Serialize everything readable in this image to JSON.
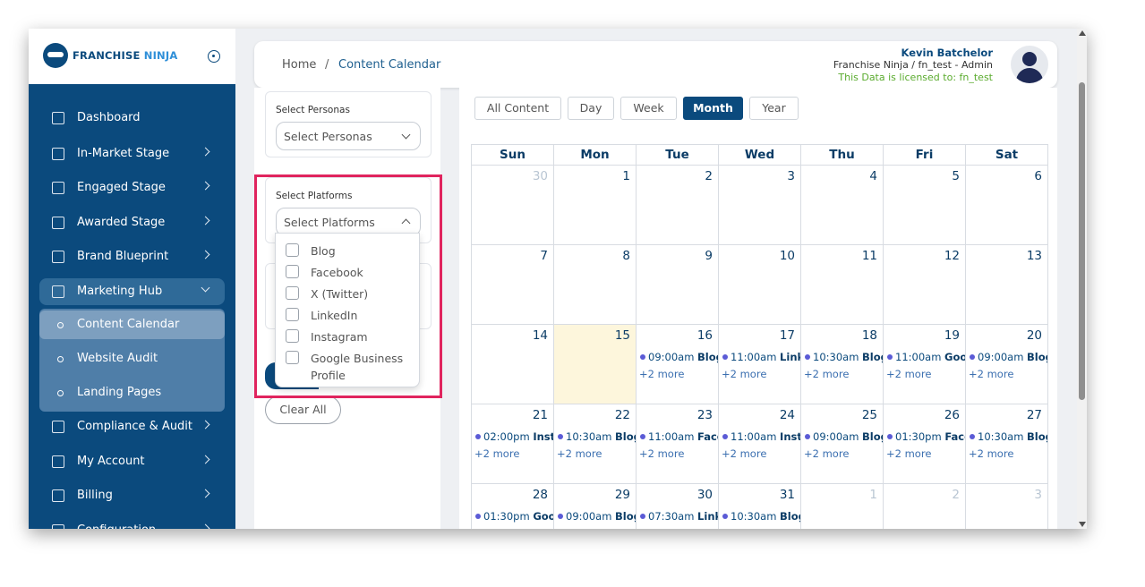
{
  "brand": {
    "name_part1": "FRANCHISE",
    "name_part2": "NINJA"
  },
  "sidebar": {
    "items": [
      {
        "label": "Dashboard",
        "icon": "home-icon",
        "chevron": false
      },
      {
        "label": "In-Market Stage",
        "icon": "store-icon",
        "chevron": true
      },
      {
        "label": "Engaged Stage",
        "icon": "people-icon",
        "chevron": true
      },
      {
        "label": "Awarded Stage",
        "icon": "runner-icon",
        "chevron": true
      },
      {
        "label": "Brand Blueprint",
        "icon": "book-icon",
        "chevron": true
      },
      {
        "label": "Marketing Hub",
        "icon": "network-icon",
        "chevron": true,
        "expanded": true
      },
      {
        "label": "Compliance & Audit",
        "icon": "clipboard-icon",
        "chevron": true
      },
      {
        "label": "My Account",
        "icon": "user-icon",
        "chevron": true
      },
      {
        "label": "Billing",
        "icon": "card-icon",
        "chevron": true
      },
      {
        "label": "Configuration",
        "icon": "gear-icon",
        "chevron": true
      }
    ],
    "submenu": [
      {
        "label": "Content Calendar",
        "selected": true
      },
      {
        "label": "Website Audit",
        "selected": false
      },
      {
        "label": "Landing Pages",
        "selected": false
      }
    ]
  },
  "breadcrumb": {
    "home": "Home",
    "separator": "/",
    "current": "Content Calendar"
  },
  "user": {
    "name": "Kevin Batchelor",
    "org": "Franchise Ninja / fn_test - Admin",
    "license": "This Data is licensed to: fn_test"
  },
  "filters": {
    "personas": {
      "label": "Select Personas",
      "placeholder": "Select Personas"
    },
    "platforms": {
      "label": "Select Platforms",
      "placeholder": "Select Platforms",
      "options": [
        "Blog",
        "Facebook",
        "X (Twitter)",
        "LinkedIn",
        "Instagram",
        "Google Business Profile"
      ]
    },
    "clear_label": "Clear All"
  },
  "calendar": {
    "views": [
      {
        "label": "All Content",
        "active": false
      },
      {
        "label": "Day",
        "active": false
      },
      {
        "label": "Week",
        "active": false
      },
      {
        "label": "Month",
        "active": true
      },
      {
        "label": "Year",
        "active": false
      }
    ],
    "weekdays": [
      "Sun",
      "Mon",
      "Tue",
      "Wed",
      "Thu",
      "Fri",
      "Sat"
    ],
    "weeks": [
      [
        {
          "d": "30",
          "muted": true
        },
        {
          "d": "1"
        },
        {
          "d": "2"
        },
        {
          "d": "3"
        },
        {
          "d": "4"
        },
        {
          "d": "5"
        },
        {
          "d": "6"
        }
      ],
      [
        {
          "d": "7"
        },
        {
          "d": "8"
        },
        {
          "d": "9"
        },
        {
          "d": "10"
        },
        {
          "d": "11"
        },
        {
          "d": "12"
        },
        {
          "d": "13"
        }
      ],
      [
        {
          "d": "14"
        },
        {
          "d": "15",
          "today": true
        },
        {
          "d": "16",
          "time": "09:00am",
          "title": "Blog",
          "more": "+2 more"
        },
        {
          "d": "17",
          "time": "11:00am",
          "title": "Linke",
          "more": "+2 more"
        },
        {
          "d": "18",
          "time": "10:30am",
          "title": "Blog",
          "more": "+2 more"
        },
        {
          "d": "19",
          "time": "11:00am",
          "title": "Goog",
          "more": "+2 more"
        },
        {
          "d": "20",
          "time": "09:00am",
          "title": "Blog",
          "more": "+2 more"
        }
      ],
      [
        {
          "d": "21",
          "time": "02:00pm",
          "title": "Insta",
          "more": "+2 more"
        },
        {
          "d": "22",
          "time": "10:30am",
          "title": "Blog",
          "more": "+2 more"
        },
        {
          "d": "23",
          "time": "11:00am",
          "title": "Facel",
          "more": "+2 more"
        },
        {
          "d": "24",
          "time": "11:00am",
          "title": "Insta",
          "more": "+2 more"
        },
        {
          "d": "25",
          "time": "09:00am",
          "title": "Blog",
          "more": "+2 more"
        },
        {
          "d": "26",
          "time": "01:30pm",
          "title": "Face",
          "more": "+2 more"
        },
        {
          "d": "27",
          "time": "10:30am",
          "title": "Blog",
          "more": "+2 more"
        }
      ],
      [
        {
          "d": "28",
          "time": "01:30pm",
          "title": "Goog"
        },
        {
          "d": "29",
          "time": "09:00am",
          "title": "Blog"
        },
        {
          "d": "30",
          "time": "07:30am",
          "title": "Link"
        },
        {
          "d": "31",
          "time": "10:30am",
          "title": "Blog"
        },
        {
          "d": "1",
          "muted": true
        },
        {
          "d": "2",
          "muted": true
        },
        {
          "d": "3",
          "muted": true
        }
      ]
    ]
  },
  "colors": {
    "brand": "#0b4a7d",
    "highlight": "#e0245e",
    "today": "#fdf6dc",
    "license": "#5aab2e"
  }
}
